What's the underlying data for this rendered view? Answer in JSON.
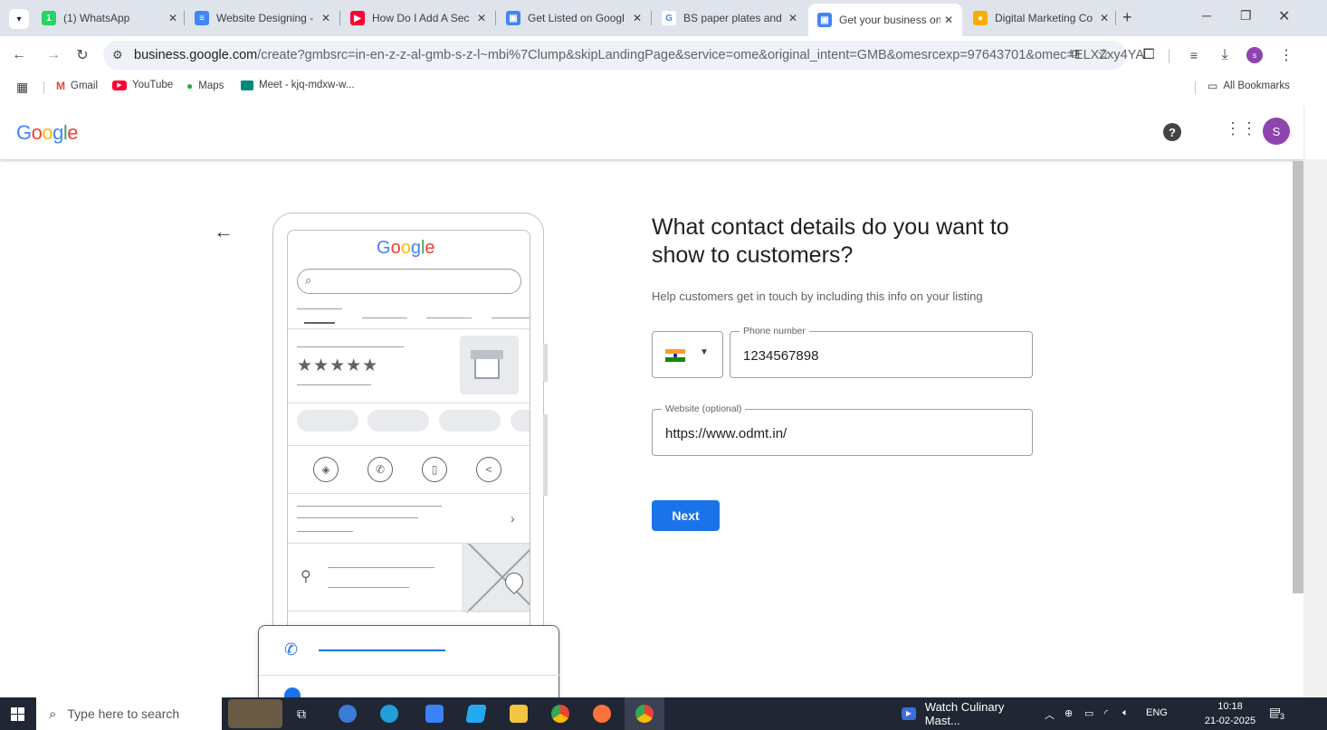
{
  "browser": {
    "tabs": [
      {
        "label": "(1) WhatsApp",
        "icon": "whatsapp-icon",
        "color": "#25d366",
        "glyph": "1"
      },
      {
        "label": "Website Designing -",
        "icon": "docs-icon",
        "color": "#4285f4",
        "glyph": "≡"
      },
      {
        "label": "How Do I Add A Sec",
        "icon": "youtube-icon",
        "color": "#ff0033",
        "glyph": "▶"
      },
      {
        "label": "Get Listed on Googl",
        "icon": "business-profile-icon",
        "color": "#4285f4",
        "glyph": "▣"
      },
      {
        "label": "BS paper plates and",
        "icon": "google-g-icon",
        "color": "#ffffff",
        "glyph": "G"
      },
      {
        "label": "Get your business on",
        "icon": "business-profile-icon",
        "color": "#4285f4",
        "glyph": "▣"
      },
      {
        "label": "Digital Marketing Co",
        "icon": "marketing-icon",
        "color": "#f9ab00",
        "glyph": "●"
      }
    ],
    "url_host": "business.google.com",
    "url_path": "/create?gmbsrc=in-en-z-z-al-gmb-s-z-l~mbi%7Clump&skipLandingPage&service=ome&original_intent=GMB&omesrcexp=97643701&omec=ELXZxy4YA...",
    "profile_initial": "s",
    "bookmarks": [
      {
        "label": "Gmail",
        "icon": "gmail-icon"
      },
      {
        "label": "YouTube",
        "icon": "youtube-icon"
      },
      {
        "label": "Maps",
        "icon": "maps-icon"
      },
      {
        "label": "Meet - kjq-mdxw-w...",
        "icon": "meet-icon"
      }
    ],
    "all_bookmarks": "All Bookmarks"
  },
  "header": {
    "logo": "Google",
    "avatar_initial": "S"
  },
  "main": {
    "heading": "What contact details do you want to show to customers?",
    "subtext": "Help customers get in touch by including this info on your listing",
    "phone": {
      "label": "Phone number",
      "value": "1234567898",
      "country": "India"
    },
    "website": {
      "label": "Website (optional)",
      "value": "https://www.odmt.in/"
    },
    "next_label": "Next"
  },
  "illustration": {
    "logo": "Google",
    "stars": "★★★★★"
  },
  "taskbar": {
    "search_placeholder": "Type here to search",
    "media_label": "Watch Culinary Mast...",
    "lang": "ENG",
    "time": "10:18",
    "date": "21-02-2025",
    "notif_count": "3"
  }
}
